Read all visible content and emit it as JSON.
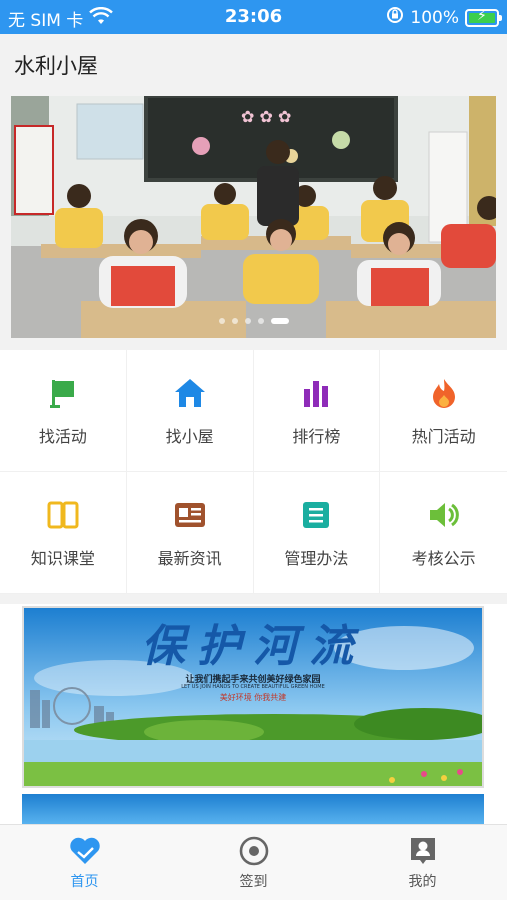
{
  "status_bar": {
    "carrier": "无 SIM 卡",
    "time": "23:06",
    "battery_percent": "100%",
    "battery_level": 1.0,
    "wifi_icon": "wifi-icon",
    "rotation_lock_icon": "rotation-lock-icon"
  },
  "header": {
    "title": "水利小屋"
  },
  "banner": {
    "image": "classroom-children-photo",
    "slide_count": 5,
    "active_slide": 4
  },
  "menu": [
    {
      "label": "找活动",
      "icon": "flag-icon",
      "color": "#3aaa4a"
    },
    {
      "label": "找小屋",
      "icon": "house-icon",
      "color": "#1e88e5"
    },
    {
      "label": "排行榜",
      "icon": "bar-chart-icon",
      "color": "#8e2bb8"
    },
    {
      "label": "热门活动",
      "icon": "flame-icon",
      "color": "#f0632a"
    },
    {
      "label": "知识课堂",
      "icon": "open-book-icon",
      "color": "#f0b81e"
    },
    {
      "label": "最新资讯",
      "icon": "news-card-icon",
      "color": "#a0522d"
    },
    {
      "label": "管理办法",
      "icon": "document-list-icon",
      "color": "#1aaea0"
    },
    {
      "label": "考核公示",
      "icon": "speaker-icon",
      "color": "#6cbf3a"
    }
  ],
  "poster": {
    "headline": "保护河流",
    "tagline_cn": "让我们携起手来共创美好绿色家园",
    "tagline_en": "LET US JOIN HANDS TO CREATE BEAUTIFUL GREEN HOME",
    "slogan": "美好环境 你我共建"
  },
  "bottom_nav": [
    {
      "label": "首页",
      "icon": "heart-hands-icon",
      "active": true
    },
    {
      "label": "签到",
      "icon": "target-circle-icon",
      "active": false
    },
    {
      "label": "我的",
      "icon": "profile-card-icon",
      "active": false
    }
  ],
  "colors": {
    "accent": "#2e96f0"
  }
}
